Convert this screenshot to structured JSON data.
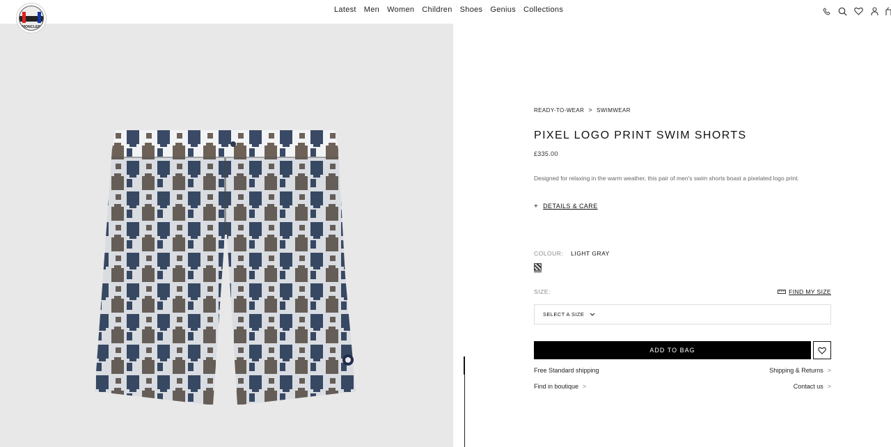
{
  "header": {
    "logo_text": "MONCLER",
    "nav": [
      "Latest",
      "Men",
      "Women",
      "Children",
      "Shoes",
      "Genius",
      "Collections"
    ],
    "icons": [
      "phone-icon",
      "search-icon",
      "heart-icon",
      "user-icon",
      "bag-icon"
    ]
  },
  "product": {
    "breadcrumb": [
      "READY-TO-WEAR",
      "SWIMWEAR"
    ],
    "breadcrumb_sep": ">",
    "title": "PIXEL LOGO PRINT SWIM SHORTS",
    "price": "£335.00",
    "description": "Designed for relaxing in the warm weather, this pair of men's swim shorts boast a pixelated logo print.",
    "details_plus": "+",
    "details_label": "DETAILS & CARE",
    "colour_label": "COLOUR:",
    "colour_value": "LIGHT GRAY",
    "size_label": "SIZE:",
    "find_size": "FIND MY SIZE",
    "select_placeholder": "SELECT A SIZE",
    "add_to_bag": "ADD TO BAG",
    "links": {
      "free_shipping": "Free Standard shipping",
      "shipping_returns": "Shipping & Returns",
      "find_boutique": "Find in boutique",
      "contact": "Contact us"
    },
    "chevron": ">"
  },
  "colors": {
    "print_navy": "#3a4a66",
    "print_brown": "#6e6258",
    "print_white": "#f2f3f5",
    "image_bg": "#e8e8e8",
    "button_bg": "#000000"
  }
}
